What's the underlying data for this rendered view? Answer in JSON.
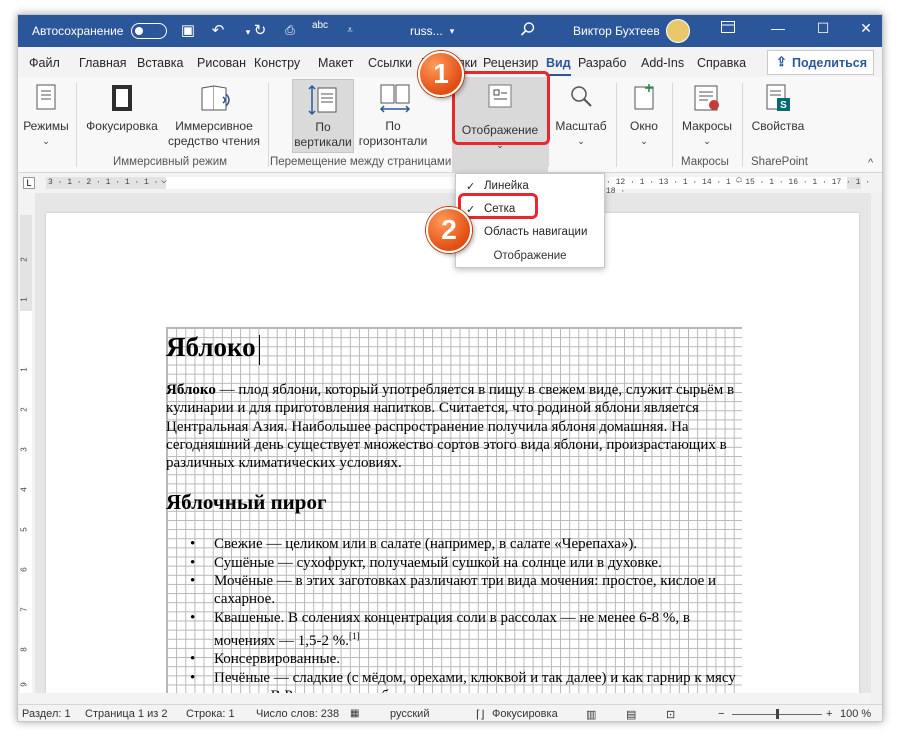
{
  "titlebar": {
    "autosave_label": "Автосохранение",
    "doc_title": "russ...",
    "search_icon": "search-icon",
    "user_name": "Виктор Бухтеев",
    "minimize": "—",
    "maximize": "☐",
    "close": "✕",
    "save_icon": "▣",
    "undo_icon": "↶",
    "redo_icon": "↻",
    "spell_icon": "abc"
  },
  "menu": {
    "tabs": [
      "Файл",
      "Главная",
      "Вставка",
      "Рисован",
      "Констру",
      "Макет",
      "Ссылки",
      "Рассылки",
      "Рецензир",
      "Вид",
      "Разрабо",
      "Add-Ins",
      "Справка"
    ],
    "active_tab": "Вид",
    "share_label": "Поделиться"
  },
  "ribbon": {
    "buttons": {
      "modes": "Режимы",
      "focus": "Фокусировка",
      "immersive_reader_1": "Иммерсивное",
      "immersive_reader_2": "средство чтения",
      "vertical_1": "По",
      "vertical_2": "вертикали",
      "horizontal_1": "По",
      "horizontal_2": "горизонтали",
      "display": "Отображение",
      "zoom": "Масштаб",
      "window": "Окно",
      "macros": "Макросы",
      "properties": "Свойства"
    },
    "groups": {
      "immersive": "Иммерсивный режим",
      "page_movement": "Перемещение между страницами",
      "macros": "Макросы",
      "sharepoint": "SharePoint"
    }
  },
  "dropdown": {
    "items": [
      {
        "label": "Линейка",
        "checked": true
      },
      {
        "label": "Сетка",
        "checked": true
      },
      {
        "label": "Область навигации",
        "checked": false
      }
    ],
    "footer": "Отображение"
  },
  "ruler": {
    "corner": "L",
    "left_ticks": "3 · 1 · 2 · 1 · 1 · 1 ·",
    "right_ticks": "· 12 · 1 · 13 · 1 · 14 · 1 · 15 · 1 · 16 · 1 · 17 · 1 · 18 ·"
  },
  "document": {
    "title": "Яблоко",
    "intro_bold": "Яблоко",
    "intro_rest": " — плод яблони, который употребляется в пищу в свежем виде, служит сырьём в кулинарии и для приготовления напитков. Считается, что родиной яблони является Центральная Азия. Наибольшее распространение получила яблоня домашняя. На сегодняшний день существует множество сортов этого вида яблони, произрастающих в различных климатических условиях.",
    "subtitle": "Яблочный пирог",
    "list": [
      "Свежие — целиком или в салате (например, в салате «Черепаха»).",
      "Сушёные — сухофрукт, получаемый сушкой на солнце или в духовке.",
      "Мочёные — в этих заготовках различают три вида мочения: простое, кислое и сахарное.",
      "Квашеные. В солениях концентрация соли в рассолах — не менее 6-8 %, в мочениях — 1,5-2 %.",
      "Консервированные.",
      "Печёные — сладкие (с мёдом, орехами, клюквой и так далее) и как гарнир к мясу и птице. В России гусь с яблоками является традиционным"
    ],
    "footnote": "[1]"
  },
  "annotations": {
    "badge1": "1",
    "badge2": "2",
    "color": "#e8282d"
  },
  "statusbar": {
    "section": "Раздел: 1",
    "page": "Страница 1 из 2",
    "line": "Строка: 1",
    "words": "Число слов: 238",
    "language": "русский",
    "focus": "Фокусировка",
    "zoom_minus": "−",
    "zoom_plus": "+",
    "zoom": "100 %"
  },
  "colors": {
    "titlebar": "#2b579a",
    "accent": "#2b579a",
    "highlight": "#e8282d"
  }
}
